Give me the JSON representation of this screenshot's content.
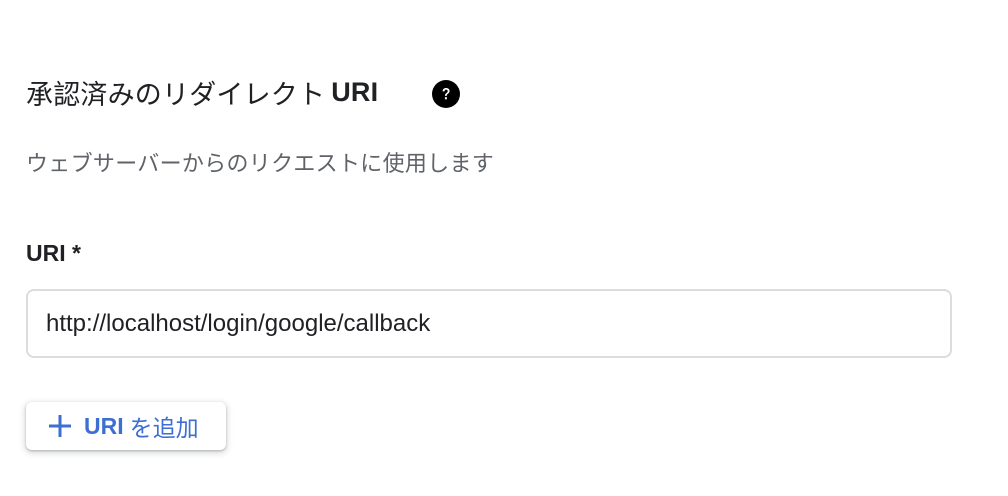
{
  "section": {
    "title": "承認済みのリダイレクト",
    "title_strong": "URI",
    "help_icon": "help-circle-icon",
    "subtitle": "ウェブサーバーからのリクエストに使用します"
  },
  "field": {
    "label": "URI *",
    "value": "http://localhost/login/google/callback"
  },
  "add_button": {
    "icon": "plus-icon",
    "label_strong": "URI",
    "label": "を追加"
  },
  "colors": {
    "accent": "#3c6fd1",
    "text": "#202124",
    "secondary_text": "#5f6368",
    "border": "#dadce0"
  }
}
